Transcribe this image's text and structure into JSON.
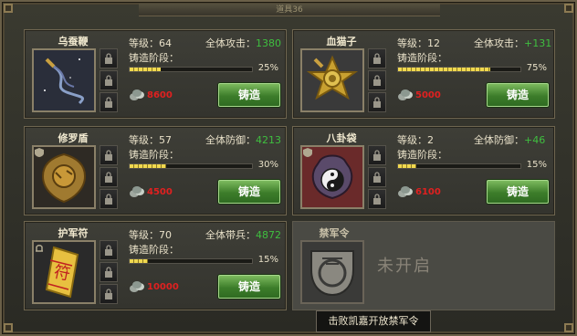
{
  "window": {
    "title": "道具36"
  },
  "cards": [
    {
      "name": "乌蚕鞭",
      "level_label": "等级：64",
      "stat_label": "全体攻击：",
      "stat_value": "1380",
      "forge_label": "铸造阶段：",
      "progress": 25,
      "progress_text": "25%",
      "cost": "8600",
      "button": "铸造",
      "icon": "whip-icon"
    },
    {
      "name": "血猫子",
      "level_label": "等级：12",
      "stat_label": "全体攻击：",
      "stat_value": "+131",
      "forge_label": "铸造阶段：",
      "progress": 75,
      "progress_text": "75%",
      "cost": "5000",
      "button": "铸造",
      "icon": "star-emblem-icon"
    },
    {
      "name": "修罗盾",
      "level_label": "等级：57",
      "stat_label": "全体防御：",
      "stat_value": "4213",
      "forge_label": "铸造阶段：",
      "progress": 30,
      "progress_text": "30%",
      "cost": "4500",
      "button": "铸造",
      "icon": "shield-icon"
    },
    {
      "name": "八卦袋",
      "level_label": "等级：2",
      "stat_label": "全体防御：",
      "stat_value": "+46",
      "forge_label": "铸造阶段：",
      "progress": 15,
      "progress_text": "15%",
      "cost": "6100",
      "button": "铸造",
      "icon": "bagua-bag-icon"
    },
    {
      "name": "护军符",
      "level_label": "等级：70",
      "stat_label": "全体带兵：",
      "stat_value": "4872",
      "forge_label": "铸造阶段：",
      "progress": 15,
      "progress_text": "15%",
      "cost": "10000",
      "button": "铸造",
      "icon": "talisman-icon"
    }
  ],
  "locked": {
    "name": "禁军令",
    "status": "未开启",
    "icon": "seal-token-icon"
  },
  "tooltip": {
    "text": "击败凯嘉开放禁军令"
  },
  "colors": {
    "stat_value": "#3fbf3f",
    "cost": "#e02020",
    "button": "#3d7d2a",
    "progress": "#f0d850"
  }
}
